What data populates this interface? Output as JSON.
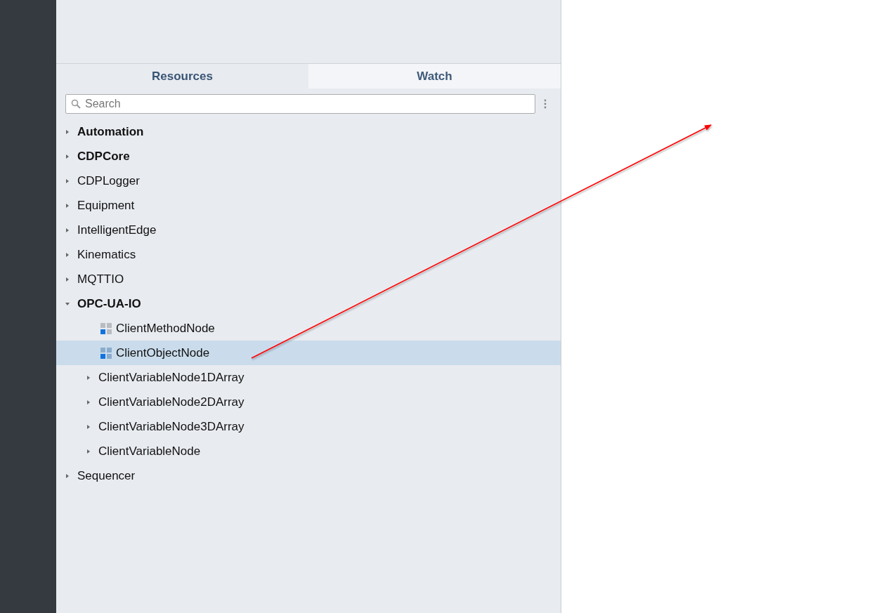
{
  "tabs": [
    {
      "label": "Resources",
      "selected": true
    },
    {
      "label": "Watch",
      "selected": false
    }
  ],
  "search": {
    "placeholder": "Search"
  },
  "tree": [
    {
      "label": "Automation",
      "bold": true,
      "expanded": false,
      "kind": "folder",
      "selected": false
    },
    {
      "label": "CDPCore",
      "bold": true,
      "expanded": false,
      "kind": "folder",
      "selected": false
    },
    {
      "label": "CDPLogger",
      "bold": false,
      "expanded": false,
      "kind": "folder",
      "selected": false
    },
    {
      "label": "Equipment",
      "bold": false,
      "expanded": false,
      "kind": "folder",
      "selected": false
    },
    {
      "label": "IntelligentEdge",
      "bold": false,
      "expanded": false,
      "kind": "folder",
      "selected": false
    },
    {
      "label": "Kinematics",
      "bold": false,
      "expanded": false,
      "kind": "folder",
      "selected": false
    },
    {
      "label": "MQTTIO",
      "bold": false,
      "expanded": false,
      "kind": "folder",
      "selected": false
    },
    {
      "label": "OPC-UA-IO",
      "bold": true,
      "expanded": true,
      "kind": "folder",
      "selected": false,
      "children": [
        {
          "label": "ClientMethodNode",
          "bold": false,
          "expanded": false,
          "kind": "object",
          "selected": false
        },
        {
          "label": "ClientObjectNode",
          "bold": false,
          "expanded": false,
          "kind": "object",
          "selected": true
        },
        {
          "label": "ClientVariableNode1DArray",
          "bold": false,
          "expanded": false,
          "kind": "folder",
          "selected": false
        },
        {
          "label": "ClientVariableNode2DArray",
          "bold": false,
          "expanded": false,
          "kind": "folder",
          "selected": false
        },
        {
          "label": "ClientVariableNode3DArray",
          "bold": false,
          "expanded": false,
          "kind": "folder",
          "selected": false
        },
        {
          "label": "ClientVariableNode",
          "bold": false,
          "expanded": false,
          "kind": "folder",
          "selected": false
        }
      ]
    },
    {
      "label": "Sequencer",
      "bold": false,
      "expanded": false,
      "kind": "folder",
      "selected": false
    }
  ]
}
